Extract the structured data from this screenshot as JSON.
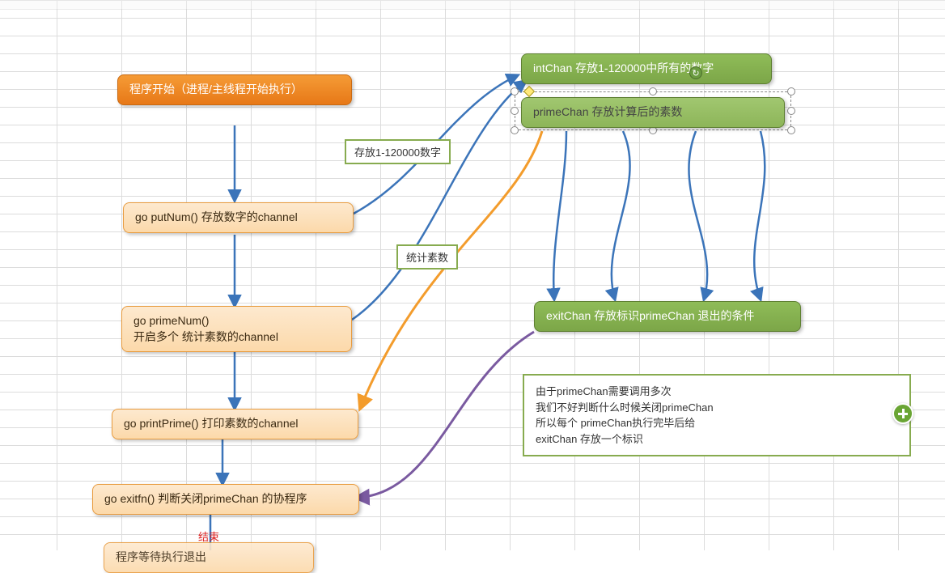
{
  "flow": {
    "start": "程序开始（进程/主线程开始执行）",
    "putNum": "go putNum()  存放数字的channel",
    "primeNum_line1": "go primeNum()",
    "primeNum_line2": "开启多个 统计素数的channel",
    "printPrime": "go printPrime()   打印素数的channel",
    "exitFn": "go exitfn()   判断关闭primeChan 的协程序",
    "endLabel": "结束",
    "bottomPartial": "程序等待执行退出"
  },
  "labels": {
    "putRange": "存放1-120000数字",
    "countPrime": "统计素数"
  },
  "channels": {
    "intChan": "intChan 存放1-120000中所有的数字",
    "primeChan": "primeChan 存放计算后的素数",
    "exitChan": "exitChan 存放标识primeChan 退出的条件"
  },
  "note": {
    "l1": "由于primeChan需要调用多次",
    "l2": "我们不好判断什么时候关闭primeChan",
    "l3": "所以每个 primeChan执行完毕后给",
    "l4": "exitChan 存放一个标识"
  },
  "colors": {
    "blue": "#3b74b9",
    "orange": "#f39c2c",
    "purple": "#7a5aa0",
    "green": "#7ca648"
  }
}
